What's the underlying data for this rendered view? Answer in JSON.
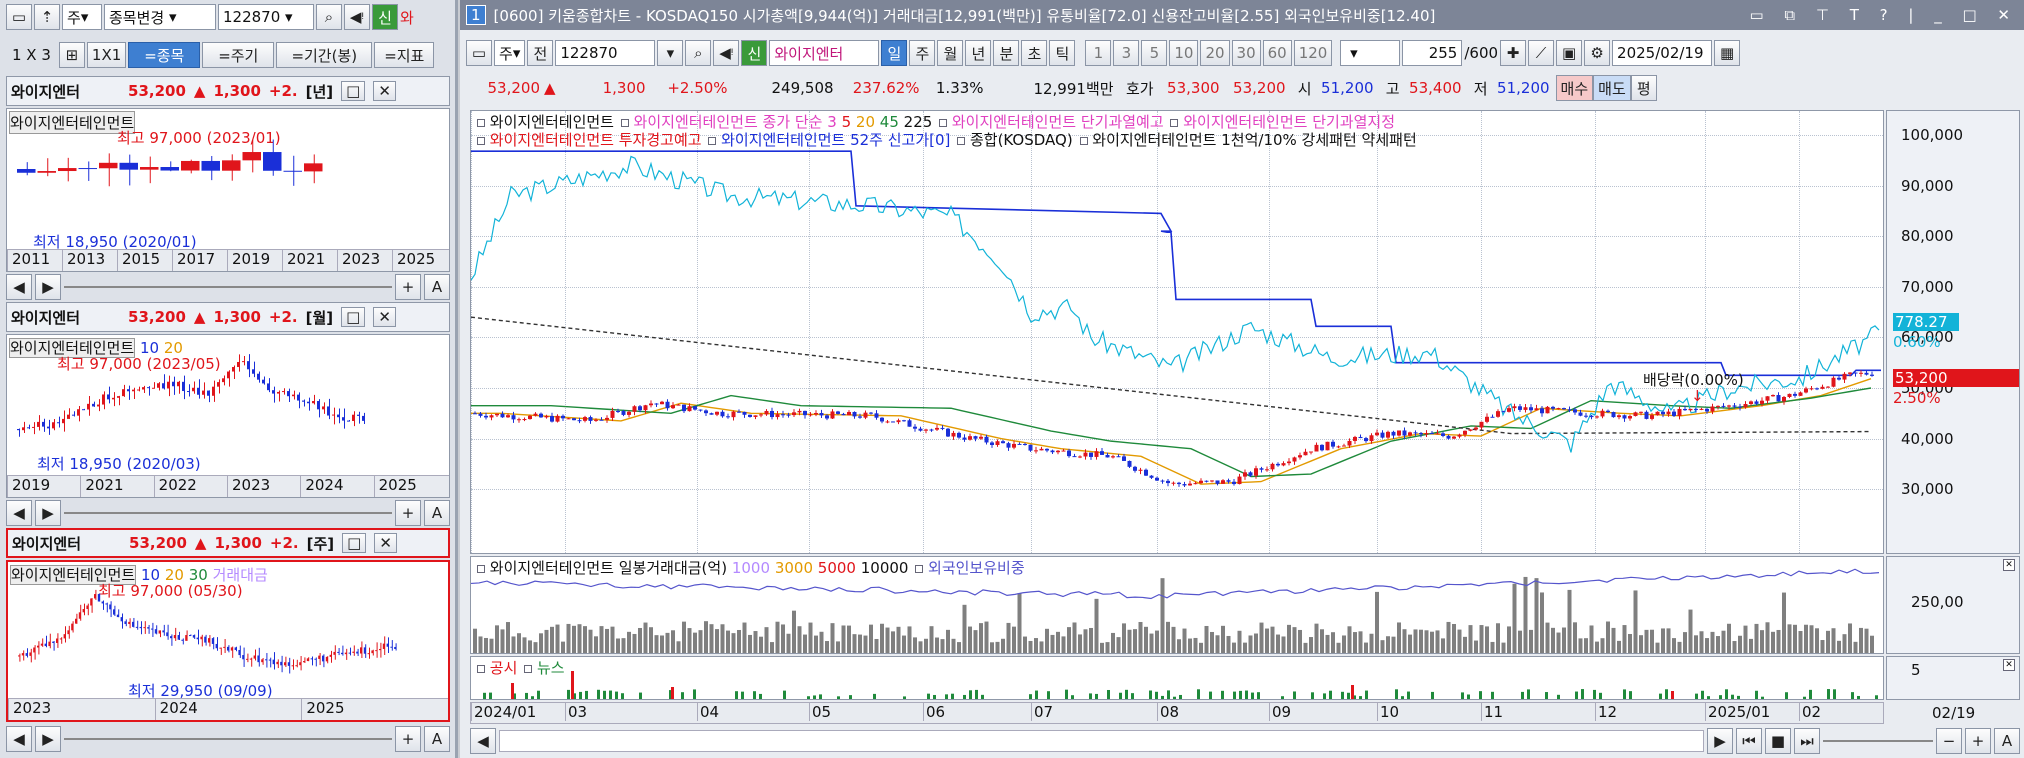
{
  "left": {
    "toolbar": {
      "period": "주",
      "mode": "종목변경",
      "code": "122870",
      "new_badge": "신",
      "extra": "와"
    },
    "layout": {
      "grid": "1 X 3",
      "one": "1X1",
      "tabs": [
        "=종목",
        "=주기",
        "=기간(봉)",
        "=지표"
      ]
    },
    "panels": [
      {
        "name": "와이지엔터",
        "price": "53,200",
        "change": "1,300",
        "pct": "+2.",
        "period": "[년]",
        "legend": "와이지엔터테인먼트",
        "high": "최고 97,000 (2023/01)",
        "low": "최저 18,950 (2020/01)",
        "xticks": [
          "2011",
          "2013",
          "2015",
          "2017",
          "2019",
          "2021",
          "2023",
          "2025"
        ]
      },
      {
        "name": "와이지엔터",
        "price": "53,200",
        "change": "1,300",
        "pct": "+2.",
        "period": "[월]",
        "legend": "와이지엔터테인먼트",
        "ma": [
          "10",
          "20"
        ],
        "high": "최고 97,000 (2023/05)",
        "low": "최저 18,950 (2020/03)",
        "xticks": [
          "2019",
          "2021",
          "2022",
          "2023",
          "2024",
          "2025"
        ]
      },
      {
        "name": "와이지엔터",
        "price": "53,200",
        "change": "1,300",
        "pct": "+2.",
        "period": "[주]",
        "legend": "와이지엔터테인먼트",
        "ma": [
          "10",
          "20",
          "30"
        ],
        "extra": "거래대금",
        "high": "최고 97,000 (05/30)",
        "low": "최저 29,950 (09/09)",
        "xticks": [
          "2023",
          "2024",
          "2025"
        ]
      }
    ]
  },
  "title": {
    "num": "1",
    "text": "[0600] 키움종합차트 - KOSDAQ150 시가총액[9,944(억)] 거래대금[12,991(백만)] 유통비율[72.0] 신용잔고비율[2.55] 외국인보유비중[12.40]"
  },
  "toolbar": {
    "period": "주",
    "prev": "전",
    "code": "122870",
    "new_badge": "신",
    "stock": "와이지엔터",
    "periods": [
      "일",
      "주",
      "월",
      "년",
      "분",
      "초",
      "틱"
    ],
    "active_period": "일",
    "nums": [
      "1",
      "3",
      "5",
      "10",
      "20",
      "30",
      "60",
      "120"
    ],
    "count": "255",
    "total": "/600",
    "date": "2025/02/19"
  },
  "quote": {
    "price": "53,200",
    "change": "1,300",
    "pct": "+2.50%",
    "volume": "249,508",
    "vol_ratio": "237.62%",
    "turnover": "1.33%",
    "amount": "12,991백만",
    "hoga_label": "호가",
    "ask": "53,300",
    "bid": "53,200",
    "open_label": "시",
    "open": "51,200",
    "high_label": "고",
    "high": "53,400",
    "low_label": "저",
    "low": "51,200",
    "buy": "매수",
    "sell": "매도",
    "flat": "평"
  },
  "legend": {
    "line1": [
      "와이지엔터테인먼트",
      "와이지엔터테인먼트 종가 단순",
      "3",
      "5",
      "20",
      "45",
      "225",
      "와이지엔터테인먼트 단기과열예고",
      "와이지엔터테인먼트 단기과열지정"
    ],
    "line2": [
      "와이지엔터테인먼트 투자경고예고",
      "와이지엔터테인먼트 52주 신고가[0]",
      "종합(KOSDAQ)",
      "와이지엔터테인먼트 1천억/10% 강세패턴",
      "약세패턴"
    ]
  },
  "yaxis": [
    "100,000",
    "90,000",
    "80,000",
    "70,000",
    "60,000",
    "50,000",
    "40,000",
    "30,000"
  ],
  "markers": {
    "kosdaq": "778.27",
    "kosdaq_pct": "0.60%",
    "price": "53,200",
    "price_pct": "2.50%",
    "dividend": "배당락(0.00%)"
  },
  "volume": {
    "legend": [
      "와이지엔터테인먼트 일봉거래대금(억)",
      "1000",
      "3000",
      "5000",
      "10000",
      "외국인보유비중"
    ],
    "ytick": "250,00"
  },
  "news": {
    "legend": [
      "공시",
      "뉴스"
    ],
    "ytick": "5"
  },
  "xaxis": [
    "2024/01",
    "03",
    "04",
    "05",
    "06",
    "07",
    "08",
    "09",
    "10",
    "11",
    "12",
    "2025/01",
    "02"
  ],
  "xaxis_end": "02/19",
  "colors": {
    "up": "#e0151b",
    "down": "#1a2fd8",
    "kosdaq": "#12b3d8",
    "high52": "#1a2fd8",
    "vol": "#7f7f7f",
    "foreign": "#5555cc"
  },
  "icons": [
    "window-icon",
    "pin-icon",
    "search-icon",
    "speaker-icon",
    "save-icon",
    "gear-icon",
    "calendar-icon"
  ]
}
